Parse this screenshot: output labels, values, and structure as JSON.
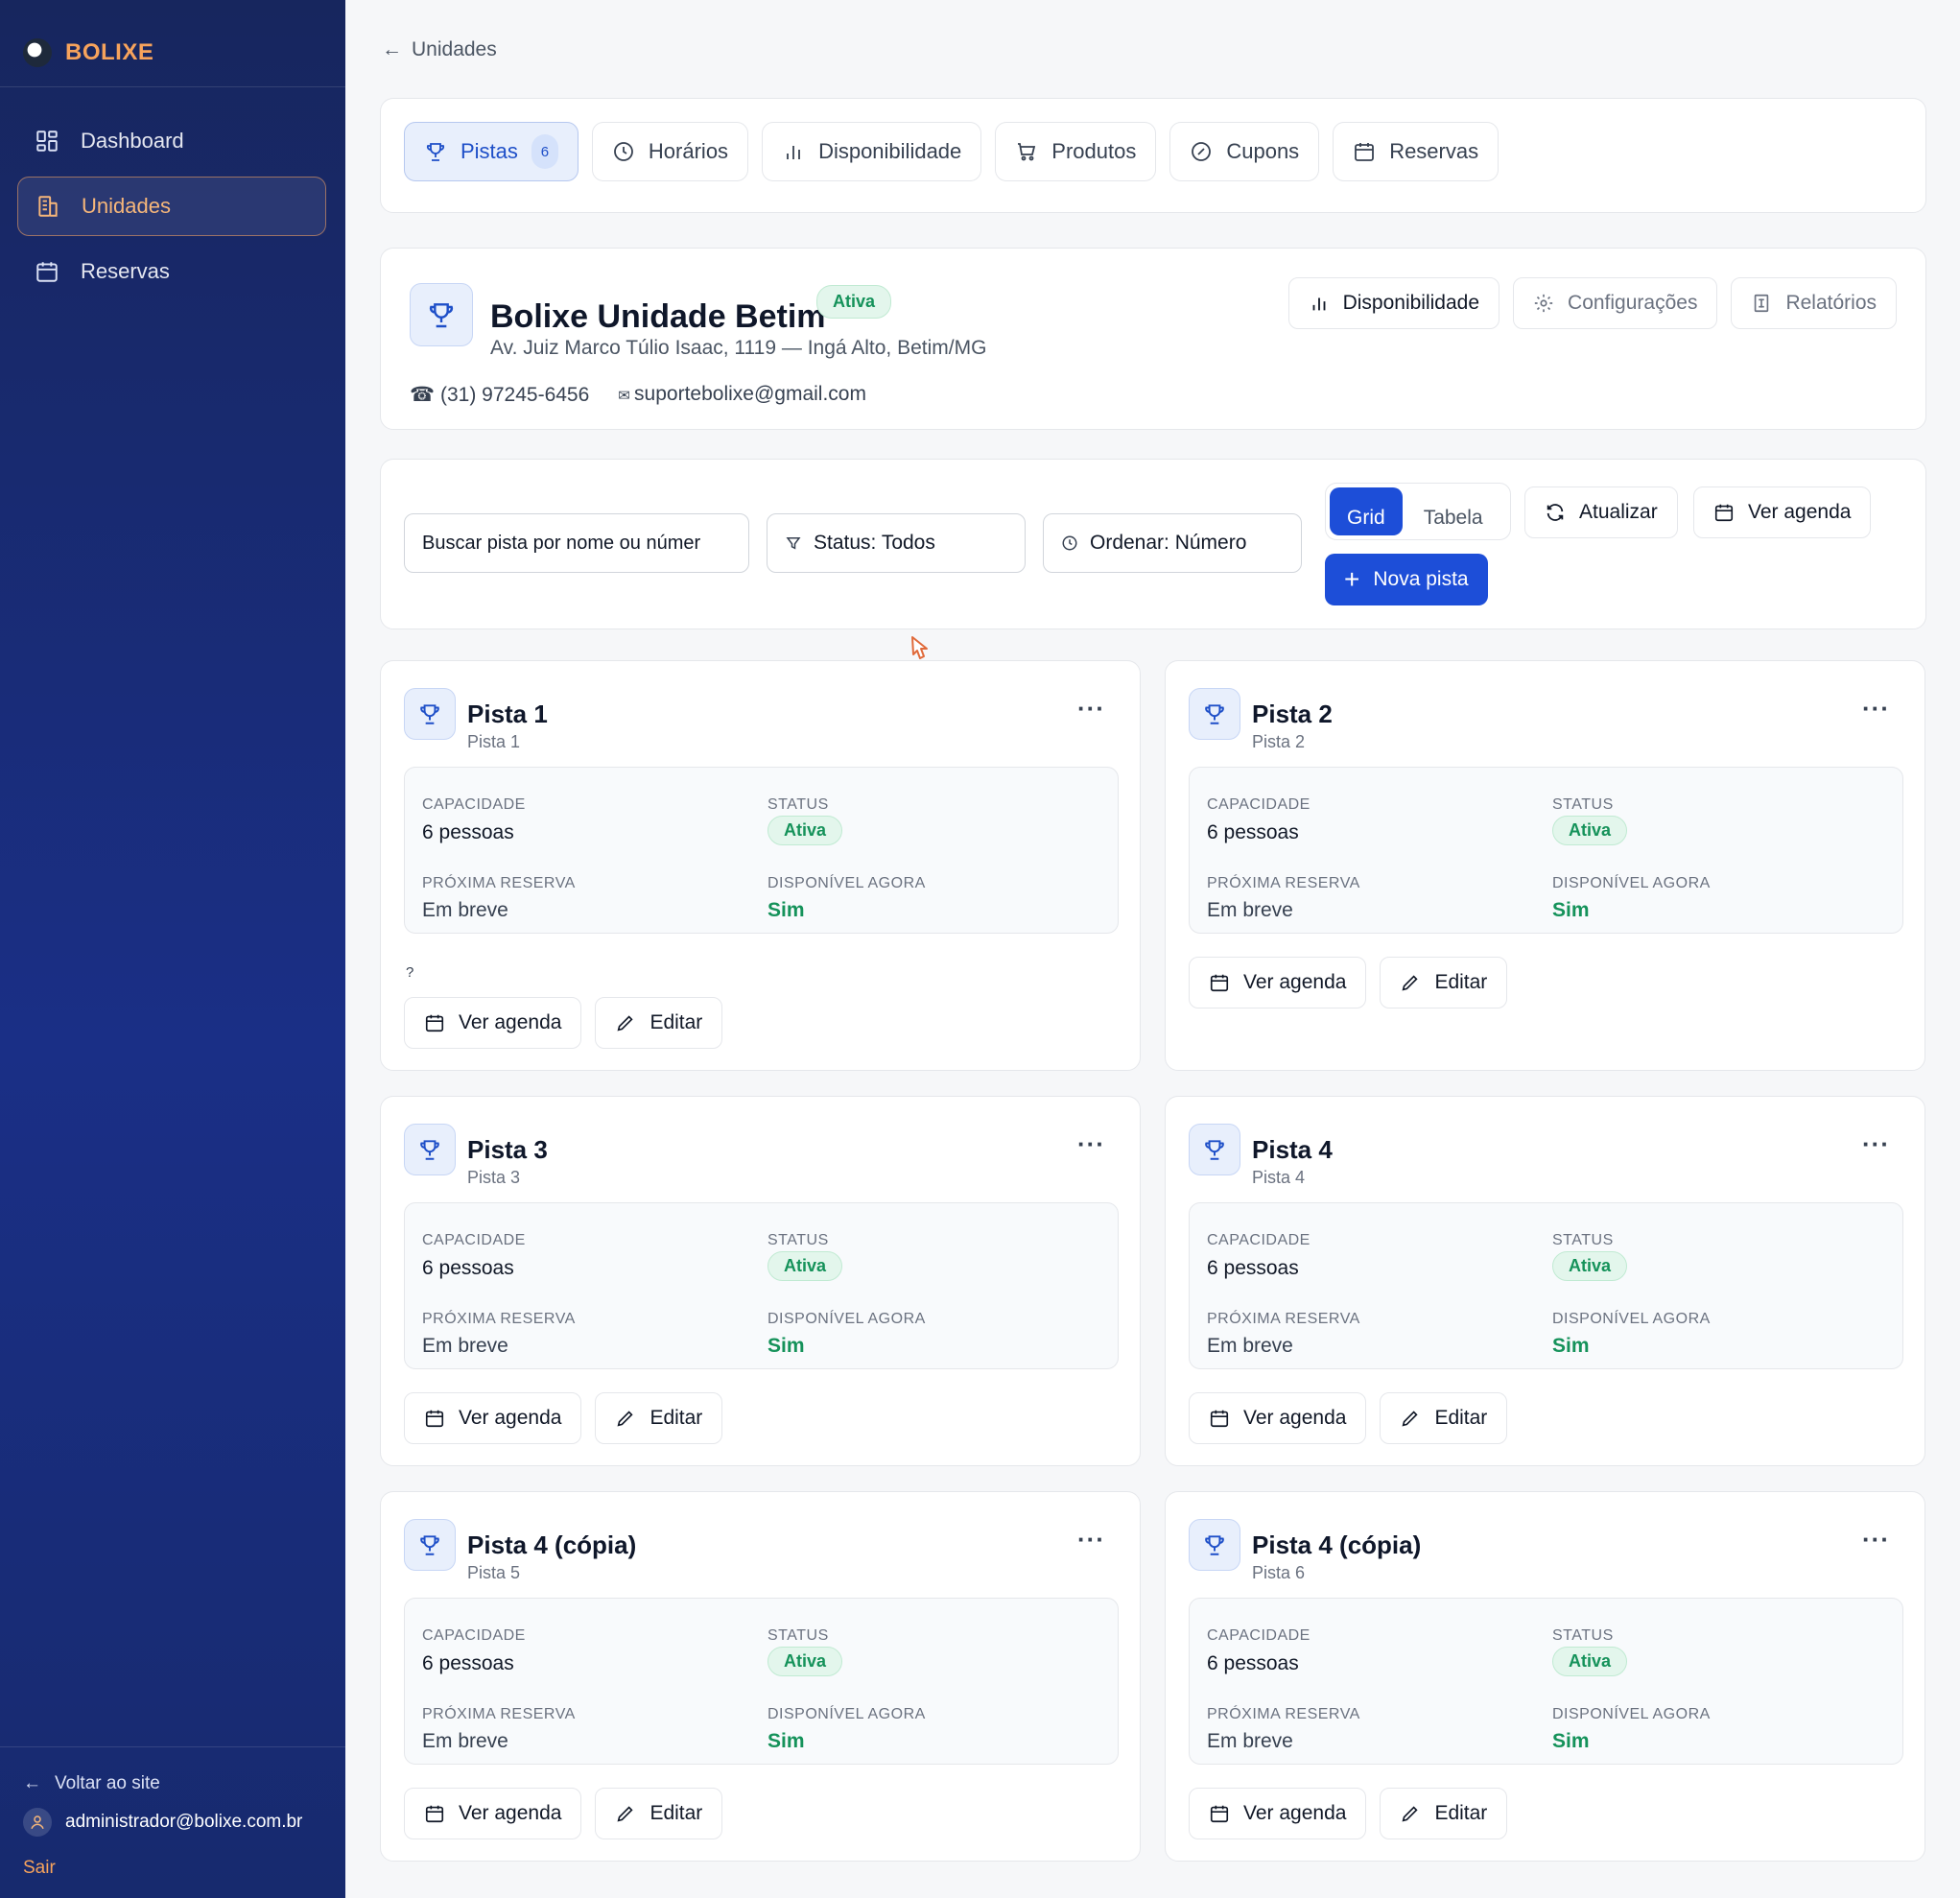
{
  "sidebar": {
    "brand": "BOLIXE",
    "nav": [
      {
        "label": "Dashboard",
        "icon": "grid-icon",
        "active": false
      },
      {
        "label": "Unidades",
        "icon": "building-icon",
        "active": true
      },
      {
        "label": "Reservas",
        "icon": "calendar-icon",
        "active": false
      }
    ],
    "back_label": "Voltar ao site",
    "user_email": "administrador@bolixe.com.br",
    "logout_label": "Sair"
  },
  "breadcrumb": {
    "label": "Unidades"
  },
  "tabs": [
    {
      "label": "Pistas",
      "badge": "6",
      "active": true
    },
    {
      "label": "Horários"
    },
    {
      "label": "Disponibilidade"
    },
    {
      "label": "Produtos"
    },
    {
      "label": "Cupons"
    },
    {
      "label": "Reservas"
    }
  ],
  "unit": {
    "name": "Bolixe Unidade Betim",
    "status": "Ativa",
    "address": "Av. Juiz Marco Túlio Isaac, 1119 — Ingá Alto, Betim/MG",
    "phone": "(31) 97245-6456",
    "email": "suportebolixe@gmail.com",
    "actions": {
      "availability": "Disponibilidade",
      "settings": "Configurações",
      "reports": "Relatórios"
    }
  },
  "filters": {
    "search_value": "Buscar pista por nome ou númer",
    "status": "Status: Todos",
    "order": "Ordenar: Número",
    "view_grid": "Grid",
    "view_table": "Tabela",
    "refresh": "Atualizar",
    "agenda": "Ver agenda",
    "new_lane": "Nova pista"
  },
  "labels": {
    "capacity": "CAPACIDADE",
    "status": "STATUS",
    "next": "PRÓXIMA RESERVA",
    "available": "DISPONÍVEL AGORA",
    "menu": "···",
    "agenda_btn": "Ver agenda",
    "edit_btn": "Editar"
  },
  "lanes": [
    {
      "title": "Pista 1",
      "subtitle": "Pista 1",
      "capacity": "6 pessoas",
      "status": "Ativa",
      "next": "Em breve",
      "available": "Sim",
      "note": "?"
    },
    {
      "title": "Pista 2",
      "subtitle": "Pista 2",
      "capacity": "6 pessoas",
      "status": "Ativa",
      "next": "Em breve",
      "available": "Sim"
    },
    {
      "title": "Pista 3",
      "subtitle": "Pista 3",
      "capacity": "6 pessoas",
      "status": "Ativa",
      "next": "Em breve",
      "available": "Sim"
    },
    {
      "title": "Pista 4",
      "subtitle": "Pista 4",
      "capacity": "6 pessoas",
      "status": "Ativa",
      "next": "Em breve",
      "available": "Sim"
    },
    {
      "title": "Pista 4 (cópia)",
      "subtitle": "Pista 5",
      "capacity": "6 pessoas",
      "status": "Ativa",
      "next": "Em breve",
      "available": "Sim"
    },
    {
      "title": "Pista 4 (cópia)",
      "subtitle": "Pista 6",
      "capacity": "6 pessoas",
      "status": "Ativa",
      "next": "Em breve",
      "available": "Sim"
    }
  ],
  "colors": {
    "primary": "#1d4ed8",
    "accent": "#f7a35c",
    "success": "#15925a",
    "sidebar": "#1a2f86"
  }
}
